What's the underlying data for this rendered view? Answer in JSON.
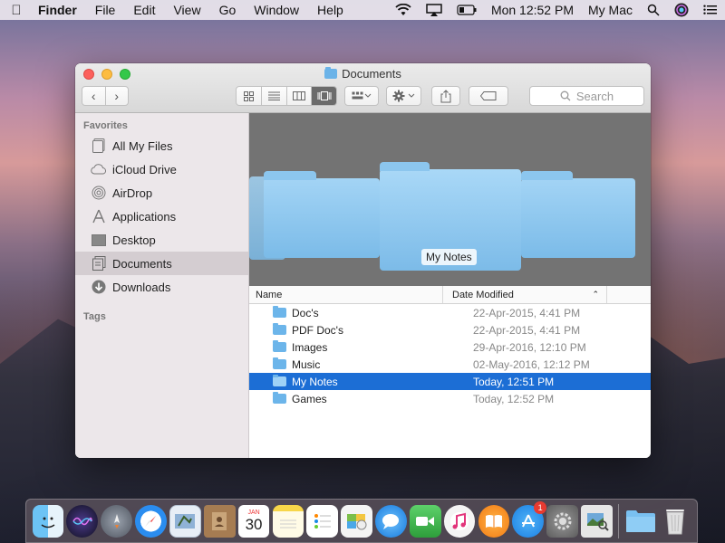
{
  "menubar": {
    "app_name": "Finder",
    "menus": [
      "File",
      "Edit",
      "View",
      "Go",
      "Window",
      "Help"
    ],
    "clock": "Mon 12:52 PM",
    "user": "My Mac"
  },
  "window": {
    "title": "Documents",
    "search_placeholder": "Search"
  },
  "sidebar": {
    "favorites_header": "Favorites",
    "items": [
      {
        "label": "All My Files",
        "icon": "all-files-icon"
      },
      {
        "label": "iCloud Drive",
        "icon": "cloud-icon"
      },
      {
        "label": "AirDrop",
        "icon": "airdrop-icon"
      },
      {
        "label": "Applications",
        "icon": "applications-icon"
      },
      {
        "label": "Desktop",
        "icon": "desktop-icon"
      },
      {
        "label": "Documents",
        "icon": "documents-icon"
      },
      {
        "label": "Downloads",
        "icon": "downloads-icon"
      }
    ],
    "tags_header": "Tags"
  },
  "coverflow": {
    "selected_label": "My Notes"
  },
  "list": {
    "col_name": "Name",
    "col_date": "Date Modified",
    "rows": [
      {
        "name": "Doc's",
        "date": "22-Apr-2015, 4:41 PM"
      },
      {
        "name": "PDF Doc's",
        "date": "22-Apr-2015, 4:41 PM"
      },
      {
        "name": "Images",
        "date": "29-Apr-2016, 12:10 PM"
      },
      {
        "name": "Music",
        "date": "02-May-2016, 12:12 PM"
      },
      {
        "name": "My Notes",
        "date": "Today, 12:51 PM"
      },
      {
        "name": "Games",
        "date": "Today, 12:52 PM"
      }
    ]
  },
  "dock": {
    "calendar_month": "JAN",
    "calendar_day": "30",
    "appstore_badge": "1"
  },
  "colors": {
    "selection": "#1c6ed5",
    "folder": "#6cb5ea"
  }
}
